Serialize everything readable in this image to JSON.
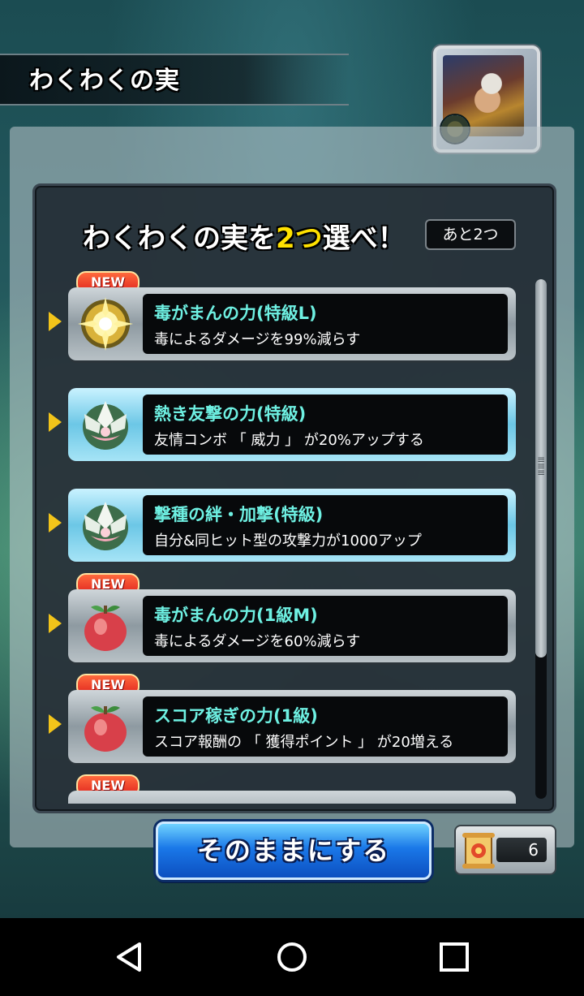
{
  "header": {
    "title": "わくわくの実"
  },
  "prompt": {
    "before": "わくわくの実を",
    "highlight": "2つ",
    "after": "選べ！",
    "remaining": "あと2つ"
  },
  "new_label": "NEW",
  "items": [
    {
      "name": "毒がまんの力(特級L)",
      "desc": "毒によるダメージを99%減らす",
      "new": true,
      "icon": "gold-fruit-icon",
      "style": "silver"
    },
    {
      "name": "熱き友撃の力(特級)",
      "desc": "友情コンボ 「 威力 」 が20%アップする",
      "new": false,
      "icon": "white-lotus-fruit-icon",
      "style": "blue"
    },
    {
      "name": "撃種の絆・加撃(特級)",
      "desc": "自分&同ヒット型の攻撃力が1000アップ",
      "new": false,
      "icon": "white-lotus-fruit-icon",
      "style": "blue"
    },
    {
      "name": "毒がまんの力(1級M)",
      "desc": "毒によるダメージを60%減らす",
      "new": true,
      "icon": "red-fruit-icon",
      "style": "silver"
    },
    {
      "name": "スコア稼ぎの力(1級)",
      "desc": "スコア報酬の 「 獲得ポイント 」 が20増える",
      "new": true,
      "icon": "red-fruit-icon",
      "style": "silver"
    }
  ],
  "footer": {
    "keep_button": "そのままにする",
    "ticket_count": "6"
  },
  "colors": {
    "item_name": "#6ef0e2",
    "highlight": "#ffe100",
    "button": "#1a78e8"
  }
}
